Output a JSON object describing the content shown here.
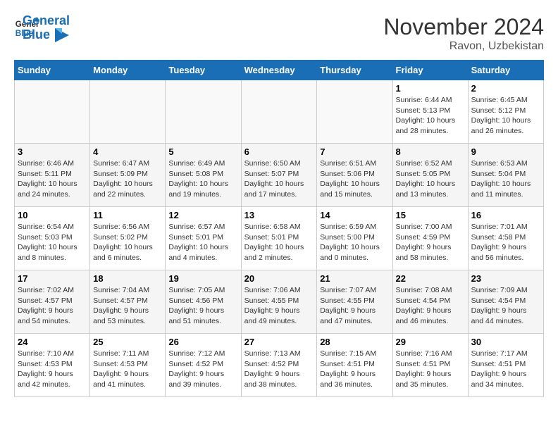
{
  "header": {
    "logo_line1": "General",
    "logo_line2": "Blue",
    "month_title": "November 2024",
    "location": "Ravon, Uzbekistan"
  },
  "weekdays": [
    "Sunday",
    "Monday",
    "Tuesday",
    "Wednesday",
    "Thursday",
    "Friday",
    "Saturday"
  ],
  "weeks": [
    [
      {
        "day": "",
        "info": ""
      },
      {
        "day": "",
        "info": ""
      },
      {
        "day": "",
        "info": ""
      },
      {
        "day": "",
        "info": ""
      },
      {
        "day": "",
        "info": ""
      },
      {
        "day": "1",
        "info": "Sunrise: 6:44 AM\nSunset: 5:13 PM\nDaylight: 10 hours\nand 28 minutes."
      },
      {
        "day": "2",
        "info": "Sunrise: 6:45 AM\nSunset: 5:12 PM\nDaylight: 10 hours\nand 26 minutes."
      }
    ],
    [
      {
        "day": "3",
        "info": "Sunrise: 6:46 AM\nSunset: 5:11 PM\nDaylight: 10 hours\nand 24 minutes."
      },
      {
        "day": "4",
        "info": "Sunrise: 6:47 AM\nSunset: 5:09 PM\nDaylight: 10 hours\nand 22 minutes."
      },
      {
        "day": "5",
        "info": "Sunrise: 6:49 AM\nSunset: 5:08 PM\nDaylight: 10 hours\nand 19 minutes."
      },
      {
        "day": "6",
        "info": "Sunrise: 6:50 AM\nSunset: 5:07 PM\nDaylight: 10 hours\nand 17 minutes."
      },
      {
        "day": "7",
        "info": "Sunrise: 6:51 AM\nSunset: 5:06 PM\nDaylight: 10 hours\nand 15 minutes."
      },
      {
        "day": "8",
        "info": "Sunrise: 6:52 AM\nSunset: 5:05 PM\nDaylight: 10 hours\nand 13 minutes."
      },
      {
        "day": "9",
        "info": "Sunrise: 6:53 AM\nSunset: 5:04 PM\nDaylight: 10 hours\nand 11 minutes."
      }
    ],
    [
      {
        "day": "10",
        "info": "Sunrise: 6:54 AM\nSunset: 5:03 PM\nDaylight: 10 hours\nand 8 minutes."
      },
      {
        "day": "11",
        "info": "Sunrise: 6:56 AM\nSunset: 5:02 PM\nDaylight: 10 hours\nand 6 minutes."
      },
      {
        "day": "12",
        "info": "Sunrise: 6:57 AM\nSunset: 5:01 PM\nDaylight: 10 hours\nand 4 minutes."
      },
      {
        "day": "13",
        "info": "Sunrise: 6:58 AM\nSunset: 5:01 PM\nDaylight: 10 hours\nand 2 minutes."
      },
      {
        "day": "14",
        "info": "Sunrise: 6:59 AM\nSunset: 5:00 PM\nDaylight: 10 hours\nand 0 minutes."
      },
      {
        "day": "15",
        "info": "Sunrise: 7:00 AM\nSunset: 4:59 PM\nDaylight: 9 hours\nand 58 minutes."
      },
      {
        "day": "16",
        "info": "Sunrise: 7:01 AM\nSunset: 4:58 PM\nDaylight: 9 hours\nand 56 minutes."
      }
    ],
    [
      {
        "day": "17",
        "info": "Sunrise: 7:02 AM\nSunset: 4:57 PM\nDaylight: 9 hours\nand 54 minutes."
      },
      {
        "day": "18",
        "info": "Sunrise: 7:04 AM\nSunset: 4:57 PM\nDaylight: 9 hours\nand 53 minutes."
      },
      {
        "day": "19",
        "info": "Sunrise: 7:05 AM\nSunset: 4:56 PM\nDaylight: 9 hours\nand 51 minutes."
      },
      {
        "day": "20",
        "info": "Sunrise: 7:06 AM\nSunset: 4:55 PM\nDaylight: 9 hours\nand 49 minutes."
      },
      {
        "day": "21",
        "info": "Sunrise: 7:07 AM\nSunset: 4:55 PM\nDaylight: 9 hours\nand 47 minutes."
      },
      {
        "day": "22",
        "info": "Sunrise: 7:08 AM\nSunset: 4:54 PM\nDaylight: 9 hours\nand 46 minutes."
      },
      {
        "day": "23",
        "info": "Sunrise: 7:09 AM\nSunset: 4:54 PM\nDaylight: 9 hours\nand 44 minutes."
      }
    ],
    [
      {
        "day": "24",
        "info": "Sunrise: 7:10 AM\nSunset: 4:53 PM\nDaylight: 9 hours\nand 42 minutes."
      },
      {
        "day": "25",
        "info": "Sunrise: 7:11 AM\nSunset: 4:53 PM\nDaylight: 9 hours\nand 41 minutes."
      },
      {
        "day": "26",
        "info": "Sunrise: 7:12 AM\nSunset: 4:52 PM\nDaylight: 9 hours\nand 39 minutes."
      },
      {
        "day": "27",
        "info": "Sunrise: 7:13 AM\nSunset: 4:52 PM\nDaylight: 9 hours\nand 38 minutes."
      },
      {
        "day": "28",
        "info": "Sunrise: 7:15 AM\nSunset: 4:51 PM\nDaylight: 9 hours\nand 36 minutes."
      },
      {
        "day": "29",
        "info": "Sunrise: 7:16 AM\nSunset: 4:51 PM\nDaylight: 9 hours\nand 35 minutes."
      },
      {
        "day": "30",
        "info": "Sunrise: 7:17 AM\nSunset: 4:51 PM\nDaylight: 9 hours\nand 34 minutes."
      }
    ]
  ]
}
